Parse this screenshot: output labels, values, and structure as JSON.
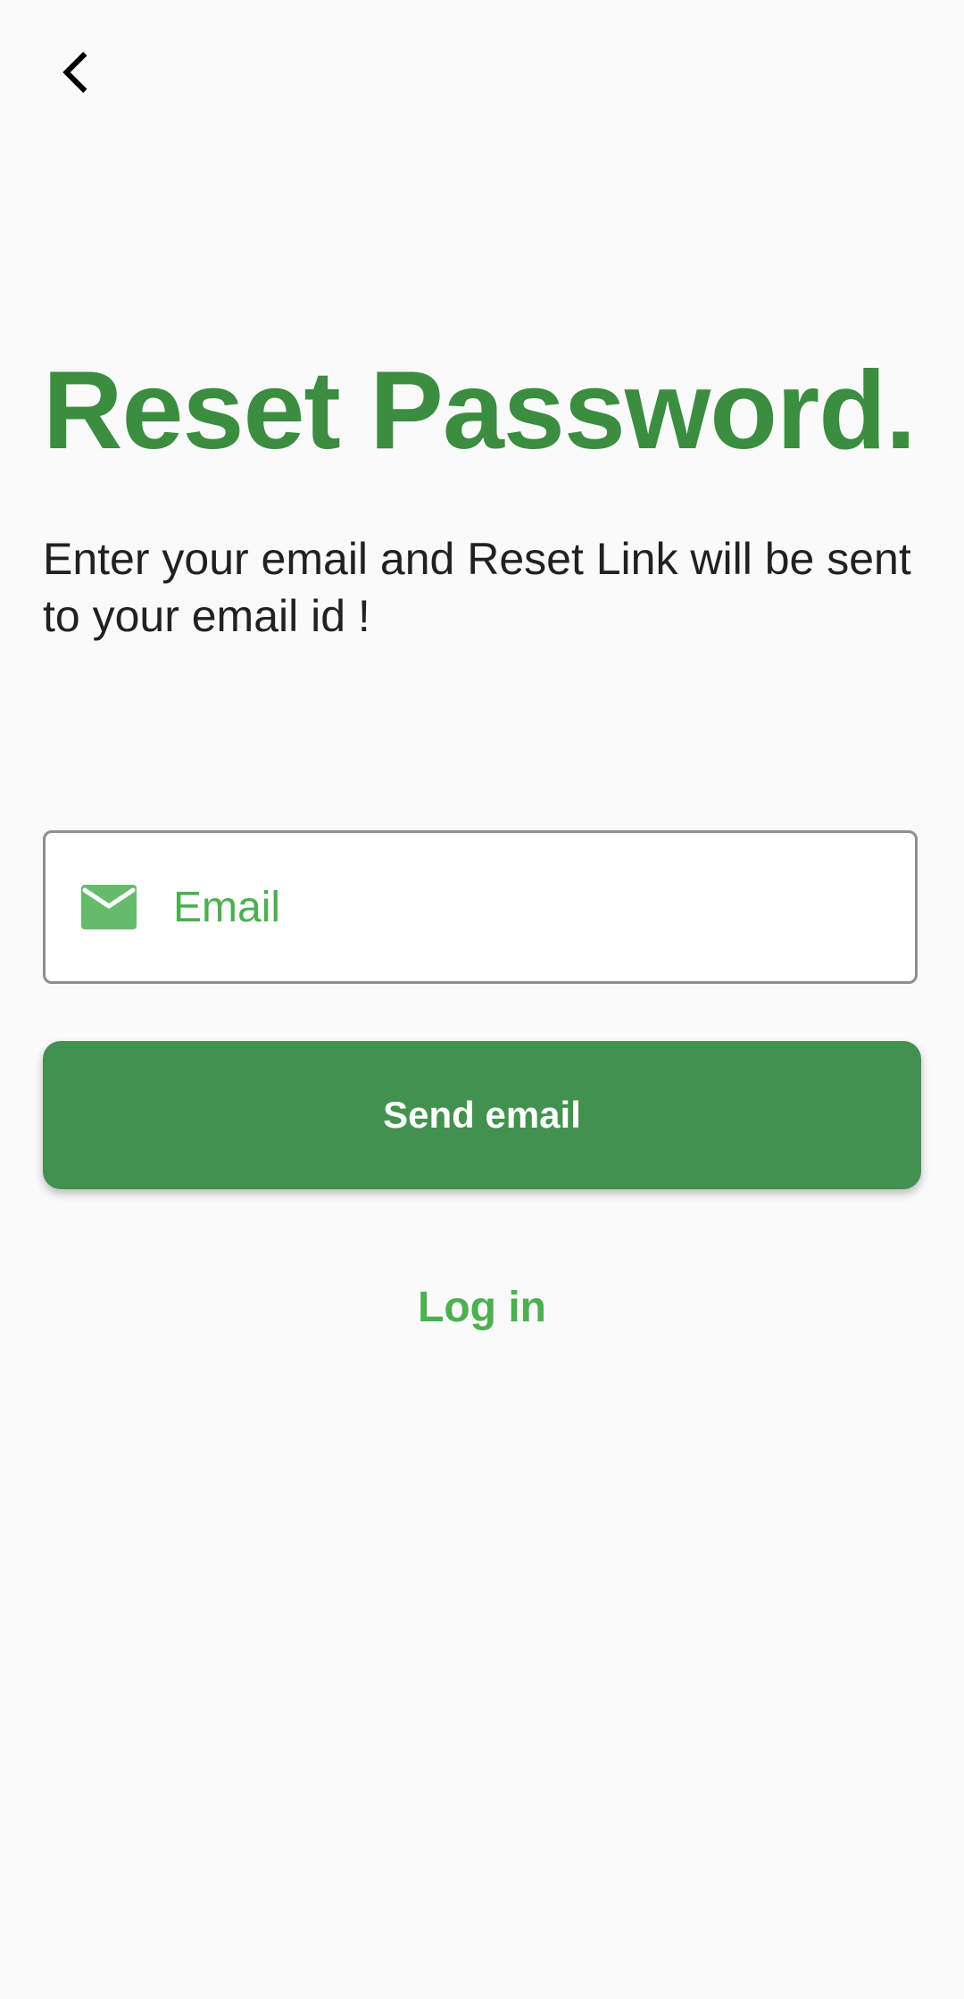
{
  "header": {
    "back_icon": "chevron-left-icon"
  },
  "main": {
    "title": "Reset Password.",
    "subtitle": "Enter your email and Reset Link will be sent to your email id !",
    "email_field": {
      "icon": "mail-icon",
      "placeholder": "Email",
      "value": ""
    },
    "send_button_label": "Send email",
    "login_link_label": "Log in"
  },
  "colors": {
    "primary_green": "#43914e",
    "title_green": "#3b8d3f",
    "accent_green": "#4caf50",
    "icon_green": "#66bb6a",
    "background": "#fafafa",
    "text_dark": "#212121"
  }
}
